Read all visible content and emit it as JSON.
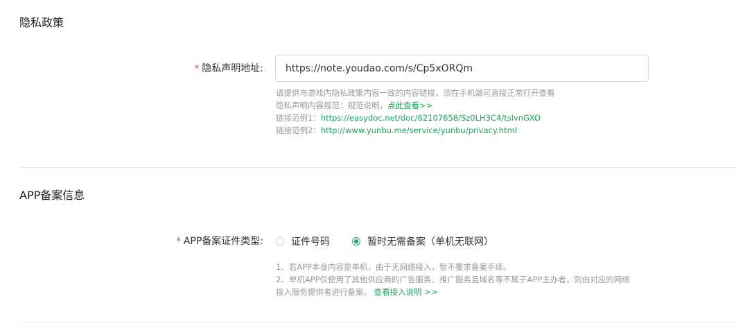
{
  "privacy": {
    "title": "隐私政策",
    "url_field": {
      "required_mark": "*",
      "label": "隐私声明地址:",
      "value": "https://note.youdao.com/s/Cp5xORQm"
    },
    "hints": {
      "line1": "请提供与游戏内隐私政策内容一致的内容链接，须在手机端可直接正常打开查看",
      "line2_text": "隐私声明内容规范：规范说明，",
      "line2_link": "点此查看>>",
      "line3_text": "链接范例1：",
      "line3_link": "https://easydoc.net/doc/62107658/Sz0LH3C4/tslvnGXO",
      "line4_text": "链接范例2：",
      "line4_link": "http://www.yunbu.me/service/yunbu/privacy.html"
    }
  },
  "app_record": {
    "title": "APP备案信息",
    "cert_type": {
      "required_mark": "*",
      "label": "APP备案证件类型:",
      "options": [
        {
          "label": "证件号码",
          "checked": false
        },
        {
          "label": "暂时无需备案（单机无联网）",
          "checked": true
        }
      ]
    },
    "notes": {
      "line1": "1、若APP本身内容是单机，由于无网络接入，暂不要求备案手续。",
      "line2": "2、单机APP仅使用了其他供应商的广告服务、推广服务且域名等不属于APP主办者，则由对应的网络",
      "line3_text": "接入服务提供者进行备案。",
      "line3_link": "查看接入说明 >>"
    }
  },
  "colors": {
    "accent": "#1ba55c",
    "required": "#f0453a",
    "hint_text": "#999999"
  }
}
